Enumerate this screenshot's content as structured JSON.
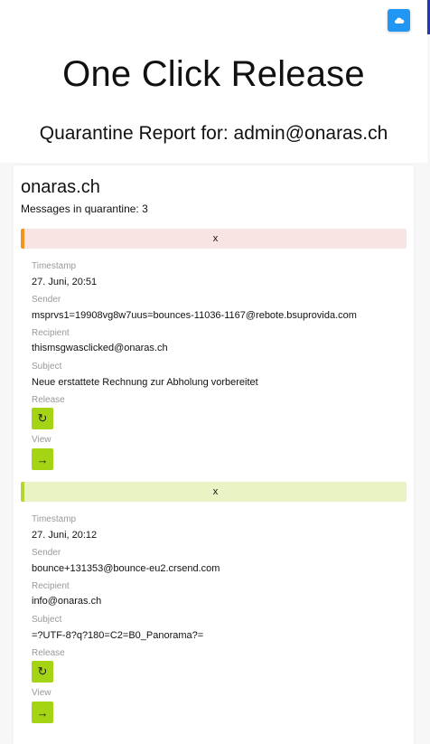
{
  "header": {
    "title": "One Click Release",
    "subtitle": "Quarantine Report for: admin@onaras.ch",
    "top_button_icon": "cloud-icon"
  },
  "domain_section": {
    "domain": "onaras.ch",
    "count_text": "Messages in quarantine: 3"
  },
  "labels": {
    "timestamp": "Timestamp",
    "sender": "Sender",
    "recipient": "Recipient",
    "subject": "Subject",
    "release": "Release",
    "view": "View"
  },
  "messages": [
    {
      "bar_label": "x",
      "bar_accent": "#f5931f",
      "timestamp": "27. Juni, 20:51",
      "sender": "msprvs1=19908vg8w7uus=bounces-11036-1167@rebote.bsuprovida.com",
      "recipient": "thismsgwasclicked@onaras.ch",
      "subject": "Neue erstattete Rechnung zur Abholung vorbereitet",
      "release_icon": "↻",
      "view_icon": "→"
    },
    {
      "bar_label": "x",
      "bar_accent": "#b5d630",
      "timestamp": "27. Juni, 20:12",
      "sender": "bounce+131353@bounce-eu2.crsend.com",
      "recipient": "info@onaras.ch",
      "subject": "=?UTF-8?q?180=C2=B0_Panorama?=",
      "release_icon": "↻",
      "view_icon": "→"
    }
  ],
  "colors": {
    "accent_blue": "#2196f3",
    "action_green": "#a5d414"
  }
}
